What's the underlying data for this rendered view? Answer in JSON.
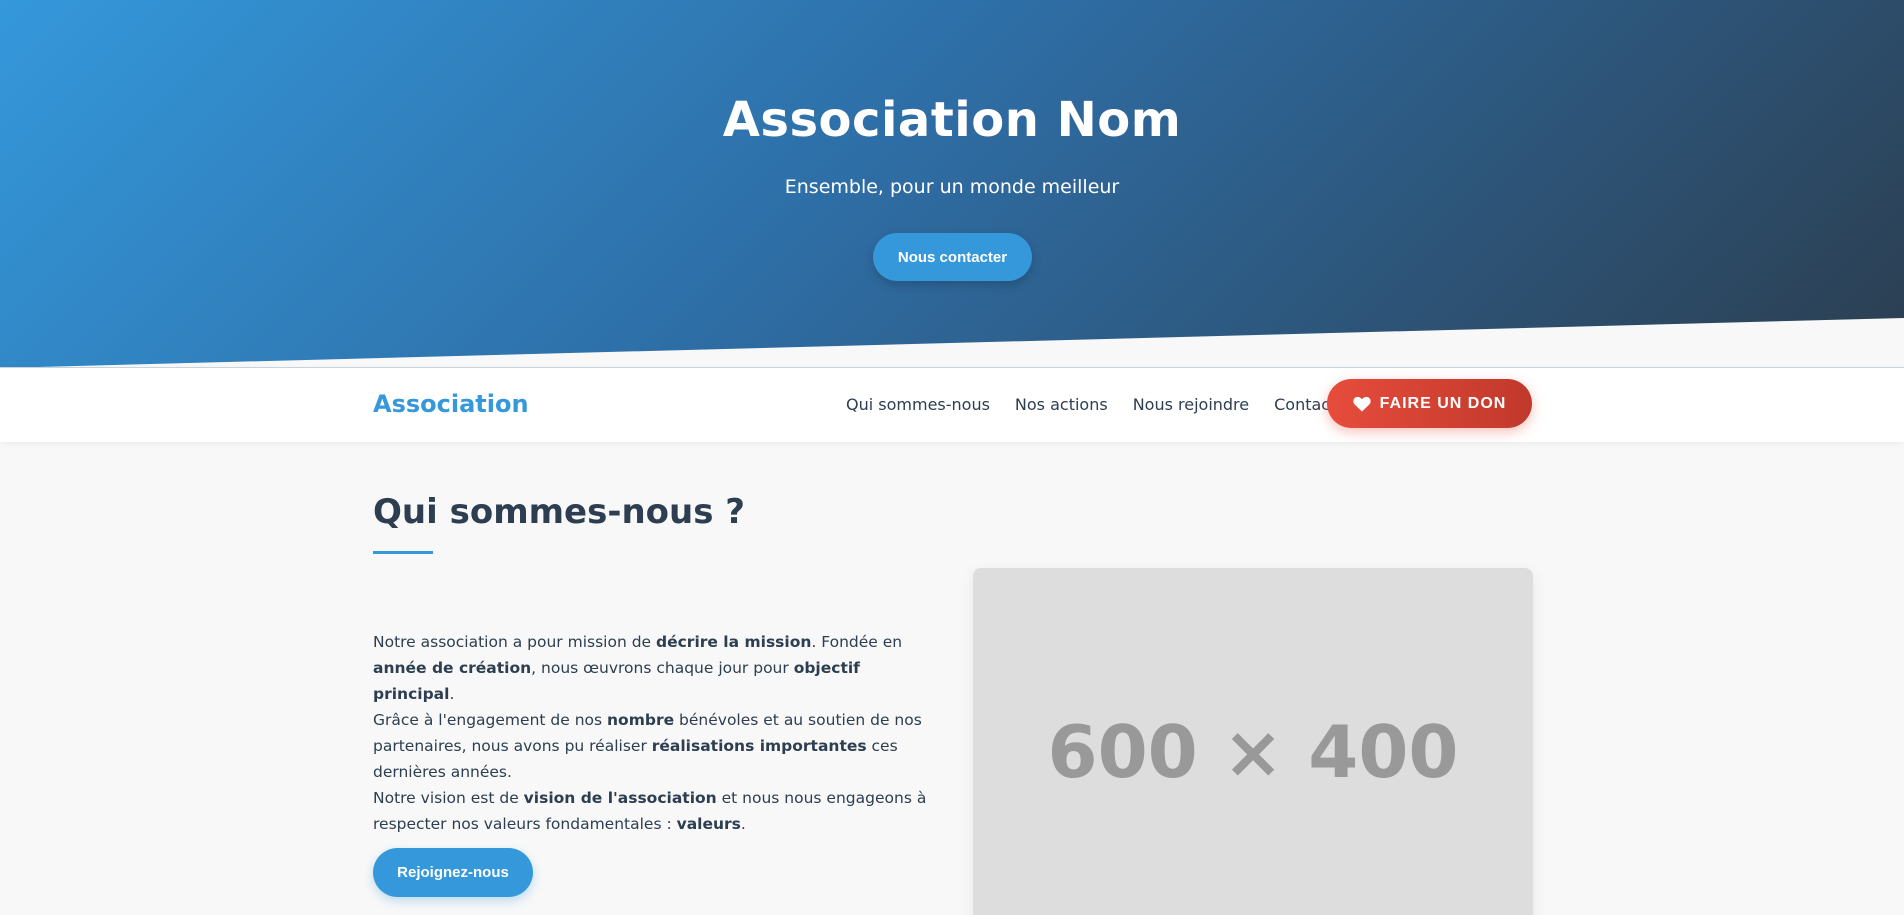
{
  "hero": {
    "title": "Association Nom",
    "subtitle": "Ensemble, pour un monde meilleur",
    "cta_label": "Nous contacter"
  },
  "nav": {
    "logo": "Association",
    "links": [
      "Qui sommes-nous",
      "Nos actions",
      "Nous rejoindre",
      "Contact"
    ],
    "donate_label": "FAIRE UN DON",
    "donate_icon": "heart-icon"
  },
  "about": {
    "title": "Qui sommes-nous ?",
    "p1_a": "Notre association a pour mission de ",
    "p1_b": "décrire la mission",
    "p1_c": ". Fondée en ",
    "p1_d": "année de création",
    "p1_e": ", nous œuvrons chaque jour pour ",
    "p1_f": "objectif principal",
    "p1_g": ".",
    "p2_a": "Grâce à l'engagement de nos ",
    "p2_b": "nombre",
    "p2_c": " bénévoles et au soutien de nos partenaires, nous avons pu réaliser ",
    "p2_d": "réalisations importantes",
    "p2_e": " ces dernières années.",
    "p3_a": "Notre vision est de ",
    "p3_b": "vision de l'association",
    "p3_c": " et nous nous engageons à respecter nos valeurs fondamentales : ",
    "p3_d": "valeurs",
    "p3_e": ".",
    "join_label": "Rejoignez-nous",
    "image_label": "600 × 400"
  },
  "colors": {
    "accent": "#3498db",
    "dark": "#2c3e50",
    "donate": "#e74c3c"
  }
}
